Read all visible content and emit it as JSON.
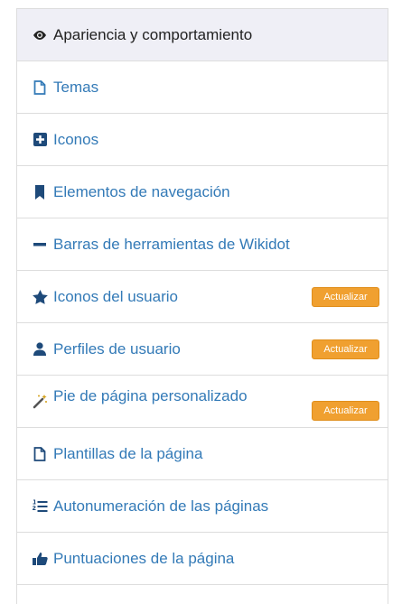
{
  "menu": {
    "items": [
      {
        "label": "Apariencia y comportamiento",
        "icon": "eye-icon"
      },
      {
        "label": "Temas",
        "icon": "file-icon"
      },
      {
        "label": "Iconos",
        "icon": "plus-square-icon"
      },
      {
        "label": "Elementos de navegación",
        "icon": "bookmark-icon"
      },
      {
        "label": "Barras de herramientas de Wikidot",
        "icon": "minus-icon"
      },
      {
        "label": "Iconos del usuario",
        "icon": "star-icon",
        "badge": "Actualizar"
      },
      {
        "label": "Perfiles de usuario",
        "icon": "user-icon",
        "badge": "Actualizar"
      },
      {
        "label": "Pie de página personalizado",
        "icon": "magic-wand-icon",
        "badge": "Actualizar"
      },
      {
        "label": "Plantillas de la página",
        "icon": "file-icon"
      },
      {
        "label": "Autonumeración de las páginas",
        "icon": "list-numbered-icon"
      },
      {
        "label": "Puntuaciones de la página",
        "icon": "thumbs-up-icon"
      }
    ]
  },
  "colors": {
    "link": "#337ab7",
    "active_bg": "#efeff6",
    "badge_bg": "#f0a030"
  }
}
